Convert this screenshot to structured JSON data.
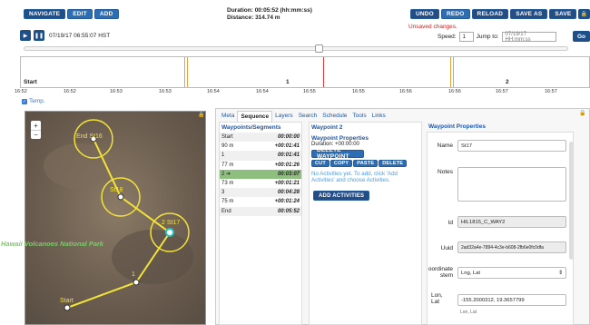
{
  "toolbar": {
    "modes": [
      "Navigate",
      "Edit",
      "Add"
    ],
    "duration": "Duration: 00:05:52 (hh:mm:ss)",
    "distance": "Distance: 314.74 m",
    "actions": [
      "Undo",
      "Redo",
      "Reload",
      "Save As",
      "Save"
    ],
    "lock_icon": "lock-icon",
    "unsaved": "Unsaved changes."
  },
  "playback": {
    "clock": "07/19/17 06:55:07 HST",
    "speed_label": "Speed:",
    "speed_value": "1",
    "jump_label": "Jump to:",
    "jump_placeholder": "07/19/17 HH:mm:ss",
    "go": "Go"
  },
  "timeline": {
    "labels": [
      "Start",
      "1",
      "2"
    ],
    "ticks": [
      "16:52",
      "16:52",
      "16:53",
      "16:53",
      "16:54",
      "16:54",
      "16:55",
      "16:55",
      "16:56",
      "16:56",
      "16:57",
      "16:57"
    ],
    "colors": {
      "marker": "#e8a33a",
      "current": "#e03a3a"
    }
  },
  "temp_label": "Temp.",
  "map": {
    "park_label": "Hawaii Volcanoes National Park",
    "waypoints": [
      "End St16",
      "St18",
      "2 St17",
      "1",
      "Start"
    ],
    "zoom_in": "+",
    "zoom_out": "−"
  },
  "tabs": [
    "Meta",
    "Sequence",
    "Layers",
    "Search",
    "Schedule",
    "Tools",
    "Links"
  ],
  "segments": {
    "header": "Waypoints/Segments",
    "rows": [
      {
        "name": "Start",
        "time": "00:00:00"
      },
      {
        "name": "90 m",
        "time": "+00:01:41"
      },
      {
        "name": "1",
        "time": "00:01:41"
      },
      {
        "name": "77 m",
        "time": "+00:01:26"
      },
      {
        "name": "2 ➔",
        "time": "00:03:07"
      },
      {
        "name": "73 m",
        "time": "+00:01:21"
      },
      {
        "name": "3",
        "time": "00:04:28"
      },
      {
        "name": "75 m",
        "time": "+00:01:24"
      },
      {
        "name": "End",
        "time": "00:05:52"
      }
    ]
  },
  "waypoint": {
    "header": "Waypoint 2",
    "sub": "Waypoint Properties",
    "duration": "Duration: +00:00:00",
    "delete": "Delete Waypoint",
    "edit": [
      "Cut",
      "Copy",
      "Paste",
      "Delete"
    ],
    "no_activities": "No Activities yet. To add, click 'Add Activities' and choose Activities.",
    "add_activities": "Add Activities"
  },
  "properties": {
    "header": "Waypoint Properties",
    "name_label": "Name",
    "name_value": "St17",
    "notes_label": "Notes",
    "id_label": "Id",
    "id_value": "HIL1815_C_WAY2",
    "uuid_label": "Uuid",
    "uuid_value": "2ad32a4e-7894-4c3e-b608-2fb6e0fc0dfa",
    "coord_label": "oordinate stem",
    "coord_value": "Lng, Lat",
    "lonlat_label": "Lon, Lat",
    "lonlat_value": "-155.2000312, 19.3657799",
    "lonlat_hint": "Lon, Lat"
  }
}
